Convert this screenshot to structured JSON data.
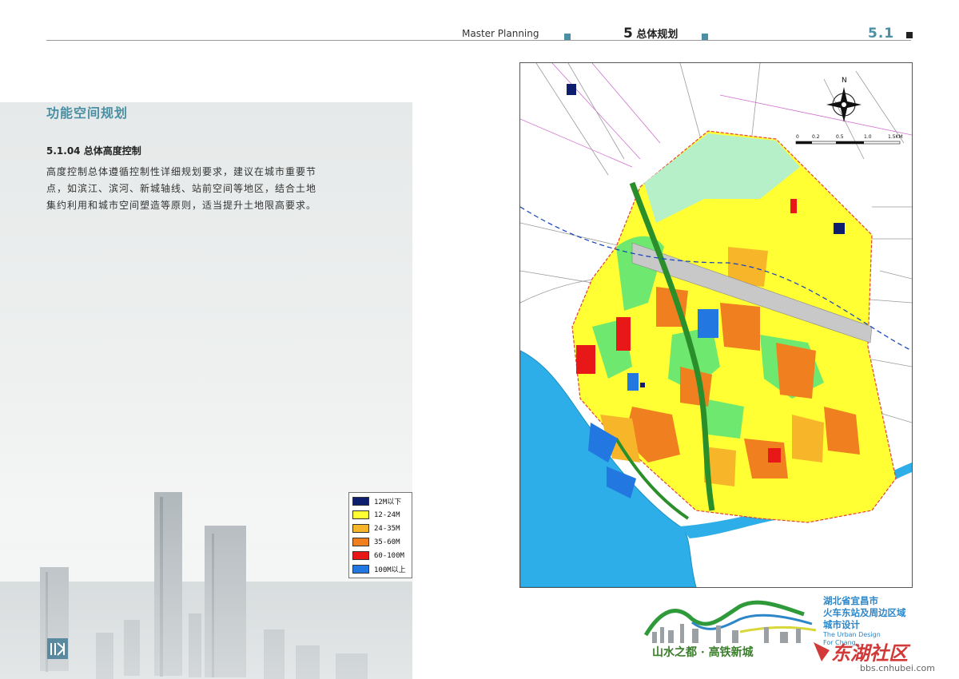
{
  "header": {
    "english_title": "Master Planning",
    "chapter_number": "5",
    "chapter_title": "总体规划",
    "page_number": "5.1"
  },
  "section": {
    "title": "功能空间规划",
    "subtitle": "5.1.04 总体高度控制",
    "paragraph": "高度控制总体遵循控制性详细规划要求，建议在城市重要节点，如滨江、滨河、新城轴线、站前空间等地区，结合土地集约利用和城市空间塑造等原则，适当提升土地限高要求。"
  },
  "legend": {
    "items": [
      {
        "label": "12M以下",
        "color": "#0d1e6e"
      },
      {
        "label": "12-24M",
        "color": "#ffff33"
      },
      {
        "label": "24-35M",
        "color": "#f7b52a"
      },
      {
        "label": "35-60M",
        "color": "#f07f1f"
      },
      {
        "label": "60-100M",
        "color": "#e81818"
      },
      {
        "label": "100M以上",
        "color": "#2277e0"
      }
    ]
  },
  "map": {
    "scale_labels": [
      "0",
      "0.2",
      "0.5",
      "1.0",
      "1.5KM"
    ],
    "north_label": "N",
    "colors": {
      "river": "#2eaee8",
      "green_space": "#6ee86e",
      "park": "#b6f0c8",
      "rail": "#9a9a9a",
      "boundary": "#e04040",
      "corridor": "#2a8f2a"
    }
  },
  "branding": {
    "project_line1": "湖北省宜昌市",
    "project_line2": "火车东站及周边区域",
    "project_line3": "城市设计",
    "english_line1": "The Urban Design",
    "english_line2": "For Chang...",
    "slogan": "山水之都 · 高铁新城"
  },
  "watermark": {
    "text": "东湖社区",
    "url": "bbs.cnhubei.com"
  },
  "accent_color": "#4a8fa3"
}
